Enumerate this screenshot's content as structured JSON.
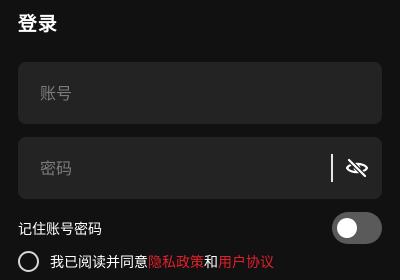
{
  "header": {
    "title": "登录"
  },
  "form": {
    "account": {
      "placeholder": "账号",
      "value": ""
    },
    "password": {
      "placeholder": "密码",
      "value": "",
      "visibility_icon": "eye-off-icon"
    },
    "remember": {
      "label": "记住账号密码",
      "enabled": false
    },
    "agreement": {
      "checked": false,
      "prefix": "我已阅读并同意",
      "privacy_link": "隐私政策",
      "connector": "和",
      "terms_link": "用户协议"
    }
  },
  "colors": {
    "background": "#111111",
    "field": "#232323",
    "link": "#e0202a",
    "toggle_off": "#5a5a5a"
  }
}
